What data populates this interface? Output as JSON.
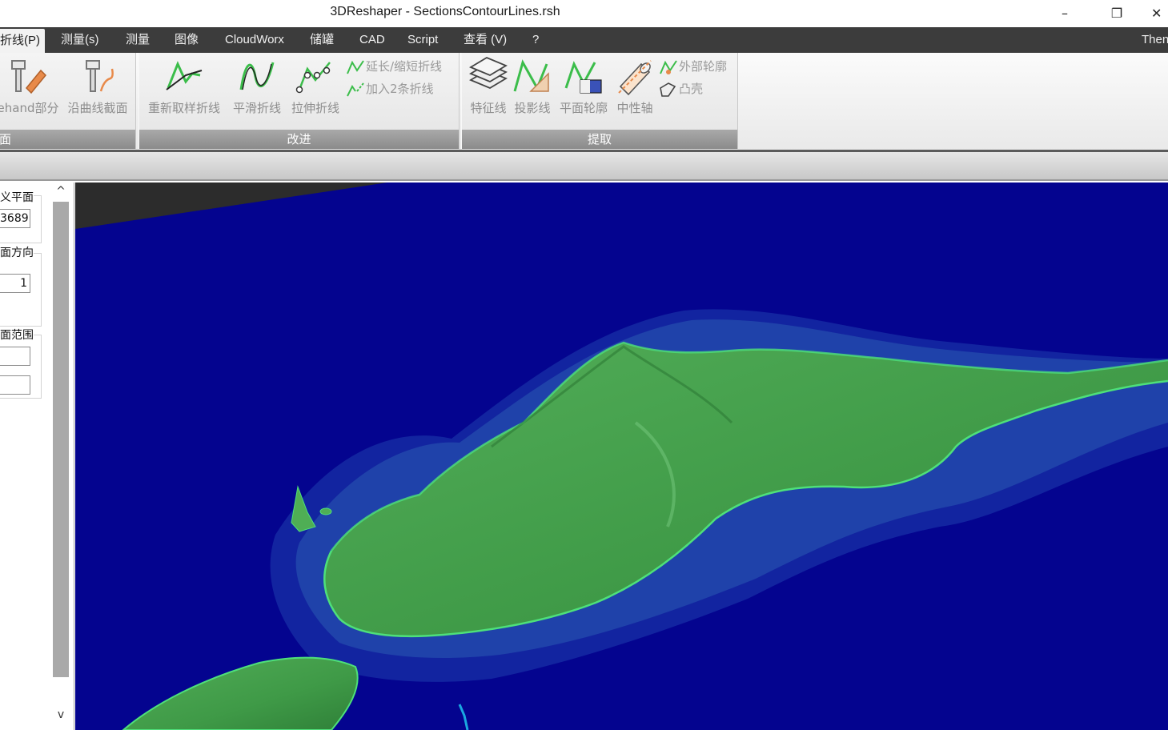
{
  "window": {
    "title": "3DReshaper - SectionsContourLines.rsh",
    "minimize": "–",
    "restore": "❐",
    "close": "✕"
  },
  "menu": {
    "items": [
      "折线(P)",
      "测量(s)",
      "测量",
      "图像",
      "CloudWorx",
      "储罐",
      "CAD",
      "Script",
      "查看 (V)",
      "?"
    ],
    "right": "Then"
  },
  "ribbon": {
    "group1": {
      "label": "面",
      "btn_freehand": "ehand部分",
      "btn_curve_section": "沿曲线截面"
    },
    "group2": {
      "label": "改进",
      "btn_resample": "重新取样折线",
      "btn_smooth": "平滑折线",
      "btn_stretch": "拉伸折线",
      "btn_extend": "延长/缩短折线",
      "btn_join": "加入2条折线"
    },
    "group3": {
      "label": "提取",
      "btn_feature": "特征线",
      "btn_projection": "投影线",
      "btn_plane_contour": "平面轮廓",
      "btn_neutral_axis": "中性轴",
      "btn_outer_contour": "外部轮廓",
      "btn_convex_hull": "凸壳"
    }
  },
  "panel": {
    "define_plane": "义平面",
    "plane_value": "3689",
    "plane_direction": "面方向",
    "direction_value": "1",
    "plane_range": "面范围",
    "range_min": "",
    "range_max": "",
    "scroll_up": "^",
    "scroll_down": "v"
  },
  "colors": {
    "viewport_bg": "#04048f",
    "terrain": "#3f9a47",
    "contour": "#4ee07a",
    "menu_bg": "#3c3c3c"
  }
}
